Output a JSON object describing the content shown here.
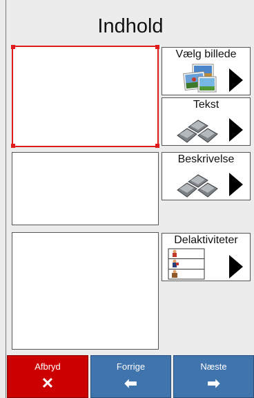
{
  "header": {
    "title": "Indhold"
  },
  "cards": [
    {
      "label": "Vælg billede",
      "icon": "photos-icon"
    },
    {
      "label": "Tekst",
      "icon": "keyboard-icon"
    },
    {
      "label": "Beskrivelse",
      "icon": "keyboard-icon"
    },
    {
      "label": "Delaktiviteter",
      "icon": "activity-list-icon"
    }
  ],
  "footer": {
    "cancel": {
      "label": "Afbryd",
      "icon": "close-icon",
      "symbol": "✕"
    },
    "previous": {
      "label": "Forrige",
      "icon": "arrow-left-icon",
      "symbol": "⬅"
    },
    "next": {
      "label": "Næste",
      "icon": "arrow-right-icon",
      "symbol": "➡"
    }
  },
  "colors": {
    "accent_red": "#cc0000",
    "nav_blue": "#3f74ad",
    "selection": "#e01b1b"
  }
}
